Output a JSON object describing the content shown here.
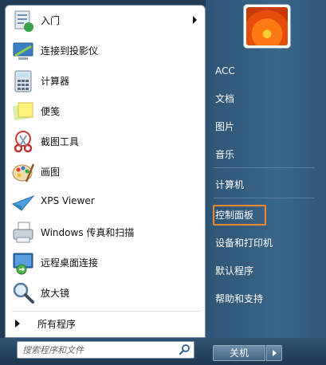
{
  "programs": [
    {
      "label": "入门",
      "icon": "getting-started-icon",
      "has_submenu": true
    },
    {
      "label": "连接到投影仪",
      "icon": "projector-icon",
      "has_submenu": false
    },
    {
      "label": "计算器",
      "icon": "calculator-icon",
      "has_submenu": false
    },
    {
      "label": "便笺",
      "icon": "sticky-notes-icon",
      "has_submenu": false
    },
    {
      "label": "截图工具",
      "icon": "snipping-tool-icon",
      "has_submenu": false
    },
    {
      "label": "画图",
      "icon": "paint-icon",
      "has_submenu": false
    },
    {
      "label": "XPS Viewer",
      "icon": "xps-viewer-icon",
      "has_submenu": false
    },
    {
      "label": "Windows 传真和扫描",
      "icon": "fax-scan-icon",
      "has_submenu": false
    },
    {
      "label": "远程桌面连接",
      "icon": "remote-desktop-icon",
      "has_submenu": false
    },
    {
      "label": "放大镜",
      "icon": "magnifier-icon",
      "has_submenu": false
    }
  ],
  "all_programs": "所有程序",
  "search": {
    "placeholder": "搜索程序和文件"
  },
  "right_items": [
    {
      "label": "ACC"
    },
    {
      "label": "文档"
    },
    {
      "label": "图片"
    },
    {
      "label": "音乐"
    },
    {
      "label": "计算机"
    },
    {
      "label": "控制面板",
      "highlighted": true
    },
    {
      "label": "设备和打印机"
    },
    {
      "label": "默认程序"
    },
    {
      "label": "帮助和支持"
    }
  ],
  "shutdown_label": "关机",
  "colors": {
    "highlight_border": "#f0892e",
    "right_pane": "#3a6689"
  }
}
